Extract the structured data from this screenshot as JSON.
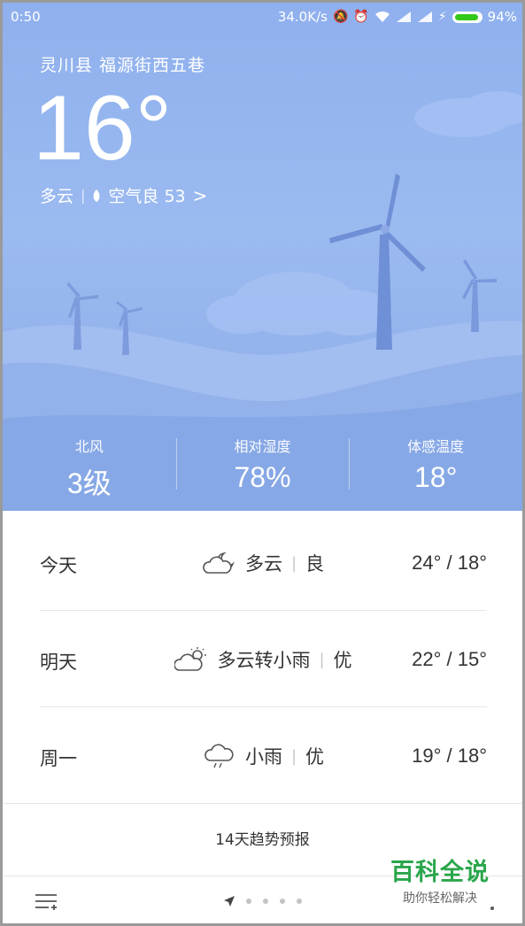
{
  "status_bar": {
    "time": "0:50",
    "net_speed": "34.0K/s",
    "battery_pct": "94%",
    "battery_level": 0.94,
    "icons": [
      "mute-bell-icon",
      "alarm-icon",
      "wifi-icon",
      "signal-icon",
      "signal-icon",
      "charging-icon",
      "battery-icon"
    ]
  },
  "header": {
    "location": "灵川县 福源街西五巷",
    "temperature": "16°",
    "condition": "多云",
    "separator": "|",
    "aqi_label": "空气良 53",
    "aqi_chevron": ">"
  },
  "stats": [
    {
      "label": "北风",
      "value": "3级"
    },
    {
      "label": "相对湿度",
      "value": "78%"
    },
    {
      "label": "体感温度",
      "value": "18°"
    }
  ],
  "forecast": [
    {
      "day": "今天",
      "icon": "cloudy-night-icon",
      "condition": "多云",
      "sep": "|",
      "air": "良",
      "range": "24° / 18°"
    },
    {
      "day": "明天",
      "icon": "partly-sunny-icon",
      "condition": "多云转小雨",
      "sep": "|",
      "air": "优",
      "range": "22° / 15°"
    },
    {
      "day": "周一",
      "icon": "light-rain-icon",
      "condition": "小雨",
      "sep": "|",
      "air": "优",
      "range": "19° / 18°"
    }
  ],
  "trend_link": "14天趋势预报",
  "watermark": {
    "title": "百科全说",
    "subtitle": "助你轻松解决"
  },
  "colors": {
    "sky": "#8fb0ee",
    "hill_far": "#a9c2f1",
    "hill_near": "#84a5e4",
    "turbine": "#6f8fd6",
    "watermark": "#2aa64b"
  }
}
